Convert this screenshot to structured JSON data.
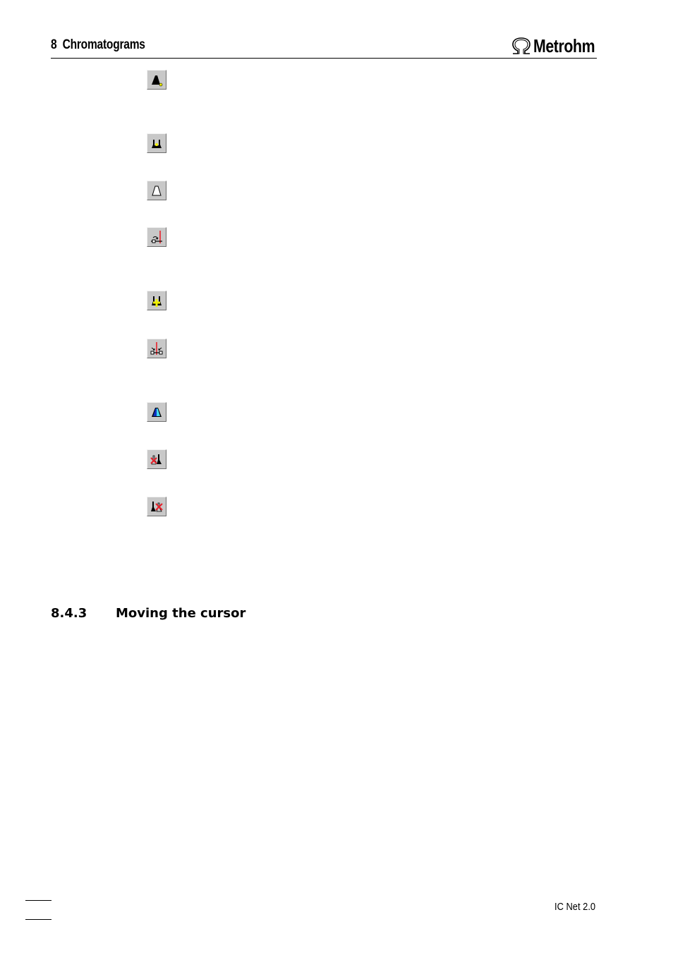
{
  "header": {
    "chapter_title": "8  Chromatograms",
    "logo_text": "Metrohm",
    "logo_symbol": "omega-icon"
  },
  "toolbar_icons": [
    {
      "name": "peak-start-marker-icon",
      "description": "Black peak with yellow dot at lower right"
    },
    {
      "name": "peak-valley-marker-icon",
      "description": "Two black peaks with yellow dot between"
    },
    {
      "name": "white-peak-icon",
      "description": "Outlined white peak"
    },
    {
      "name": "baseline-cursor-icon",
      "description": "Baseline with arrow and red vertical line"
    },
    {
      "name": "add-peak-icon",
      "description": "Two black peaks with yellow plus sign"
    },
    {
      "name": "split-peak-icon",
      "description": "Red vertical line with arrows converging on baseline"
    },
    {
      "name": "colored-peak-icon",
      "description": "Blue and cyan filled peak"
    },
    {
      "name": "delete-left-peak-icon",
      "description": "Two peaks with red X over left peak"
    },
    {
      "name": "delete-right-peak-icon",
      "description": "Two peaks with red X over right peak"
    }
  ],
  "section": {
    "number": "8.4.3",
    "title": "Moving the cursor"
  },
  "footer": {
    "product": "IC Net 2.0"
  },
  "colors": {
    "button_face": "#c8c8c8",
    "accent_yellow": "#f0f000",
    "accent_red": "#e8202a",
    "accent_blue": "#1030c0",
    "accent_cyan": "#40d8f0"
  }
}
